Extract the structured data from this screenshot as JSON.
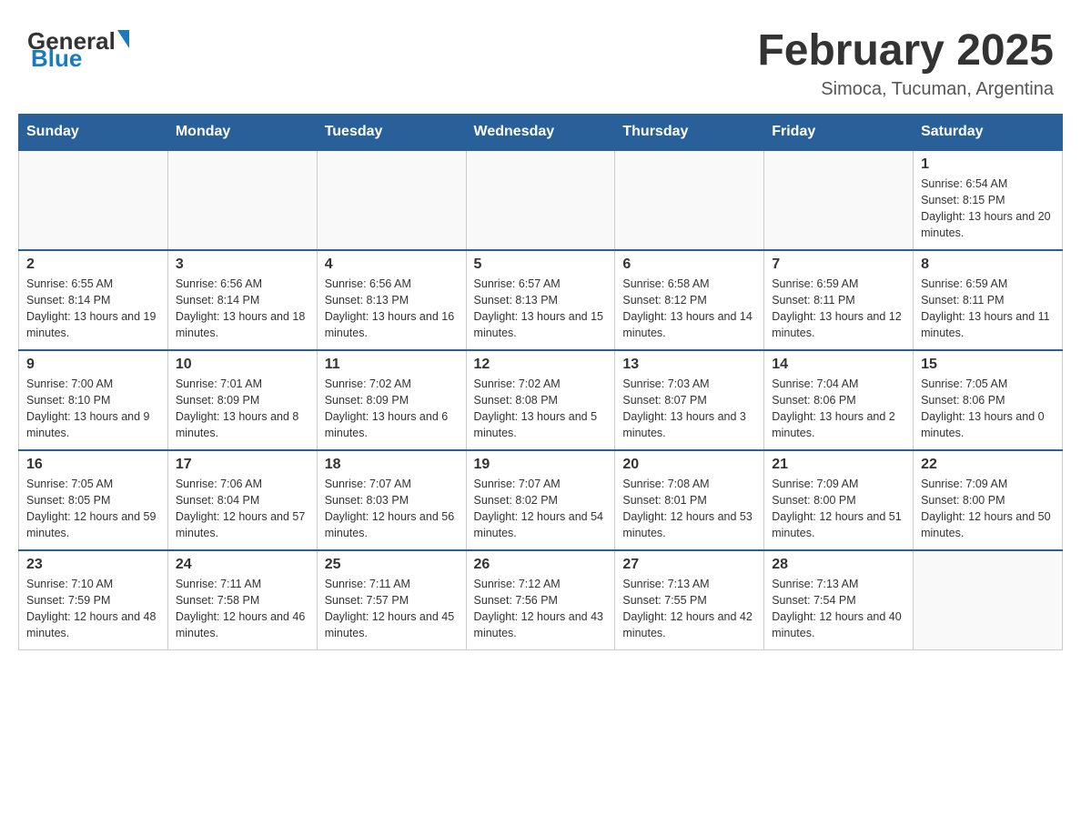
{
  "header": {
    "logo_general": "General",
    "logo_blue": "Blue",
    "month_title": "February 2025",
    "location": "Simoca, Tucuman, Argentina"
  },
  "days_of_week": [
    "Sunday",
    "Monday",
    "Tuesday",
    "Wednesday",
    "Thursday",
    "Friday",
    "Saturday"
  ],
  "weeks": [
    [
      {
        "day": "",
        "info": ""
      },
      {
        "day": "",
        "info": ""
      },
      {
        "day": "",
        "info": ""
      },
      {
        "day": "",
        "info": ""
      },
      {
        "day": "",
        "info": ""
      },
      {
        "day": "",
        "info": ""
      },
      {
        "day": "1",
        "info": "Sunrise: 6:54 AM\nSunset: 8:15 PM\nDaylight: 13 hours and 20 minutes."
      }
    ],
    [
      {
        "day": "2",
        "info": "Sunrise: 6:55 AM\nSunset: 8:14 PM\nDaylight: 13 hours and 19 minutes."
      },
      {
        "day": "3",
        "info": "Sunrise: 6:56 AM\nSunset: 8:14 PM\nDaylight: 13 hours and 18 minutes."
      },
      {
        "day": "4",
        "info": "Sunrise: 6:56 AM\nSunset: 8:13 PM\nDaylight: 13 hours and 16 minutes."
      },
      {
        "day": "5",
        "info": "Sunrise: 6:57 AM\nSunset: 8:13 PM\nDaylight: 13 hours and 15 minutes."
      },
      {
        "day": "6",
        "info": "Sunrise: 6:58 AM\nSunset: 8:12 PM\nDaylight: 13 hours and 14 minutes."
      },
      {
        "day": "7",
        "info": "Sunrise: 6:59 AM\nSunset: 8:11 PM\nDaylight: 13 hours and 12 minutes."
      },
      {
        "day": "8",
        "info": "Sunrise: 6:59 AM\nSunset: 8:11 PM\nDaylight: 13 hours and 11 minutes."
      }
    ],
    [
      {
        "day": "9",
        "info": "Sunrise: 7:00 AM\nSunset: 8:10 PM\nDaylight: 13 hours and 9 minutes."
      },
      {
        "day": "10",
        "info": "Sunrise: 7:01 AM\nSunset: 8:09 PM\nDaylight: 13 hours and 8 minutes."
      },
      {
        "day": "11",
        "info": "Sunrise: 7:02 AM\nSunset: 8:09 PM\nDaylight: 13 hours and 6 minutes."
      },
      {
        "day": "12",
        "info": "Sunrise: 7:02 AM\nSunset: 8:08 PM\nDaylight: 13 hours and 5 minutes."
      },
      {
        "day": "13",
        "info": "Sunrise: 7:03 AM\nSunset: 8:07 PM\nDaylight: 13 hours and 3 minutes."
      },
      {
        "day": "14",
        "info": "Sunrise: 7:04 AM\nSunset: 8:06 PM\nDaylight: 13 hours and 2 minutes."
      },
      {
        "day": "15",
        "info": "Sunrise: 7:05 AM\nSunset: 8:06 PM\nDaylight: 13 hours and 0 minutes."
      }
    ],
    [
      {
        "day": "16",
        "info": "Sunrise: 7:05 AM\nSunset: 8:05 PM\nDaylight: 12 hours and 59 minutes."
      },
      {
        "day": "17",
        "info": "Sunrise: 7:06 AM\nSunset: 8:04 PM\nDaylight: 12 hours and 57 minutes."
      },
      {
        "day": "18",
        "info": "Sunrise: 7:07 AM\nSunset: 8:03 PM\nDaylight: 12 hours and 56 minutes."
      },
      {
        "day": "19",
        "info": "Sunrise: 7:07 AM\nSunset: 8:02 PM\nDaylight: 12 hours and 54 minutes."
      },
      {
        "day": "20",
        "info": "Sunrise: 7:08 AM\nSunset: 8:01 PM\nDaylight: 12 hours and 53 minutes."
      },
      {
        "day": "21",
        "info": "Sunrise: 7:09 AM\nSunset: 8:00 PM\nDaylight: 12 hours and 51 minutes."
      },
      {
        "day": "22",
        "info": "Sunrise: 7:09 AM\nSunset: 8:00 PM\nDaylight: 12 hours and 50 minutes."
      }
    ],
    [
      {
        "day": "23",
        "info": "Sunrise: 7:10 AM\nSunset: 7:59 PM\nDaylight: 12 hours and 48 minutes."
      },
      {
        "day": "24",
        "info": "Sunrise: 7:11 AM\nSunset: 7:58 PM\nDaylight: 12 hours and 46 minutes."
      },
      {
        "day": "25",
        "info": "Sunrise: 7:11 AM\nSunset: 7:57 PM\nDaylight: 12 hours and 45 minutes."
      },
      {
        "day": "26",
        "info": "Sunrise: 7:12 AM\nSunset: 7:56 PM\nDaylight: 12 hours and 43 minutes."
      },
      {
        "day": "27",
        "info": "Sunrise: 7:13 AM\nSunset: 7:55 PM\nDaylight: 12 hours and 42 minutes."
      },
      {
        "day": "28",
        "info": "Sunrise: 7:13 AM\nSunset: 7:54 PM\nDaylight: 12 hours and 40 minutes."
      },
      {
        "day": "",
        "info": ""
      }
    ]
  ]
}
